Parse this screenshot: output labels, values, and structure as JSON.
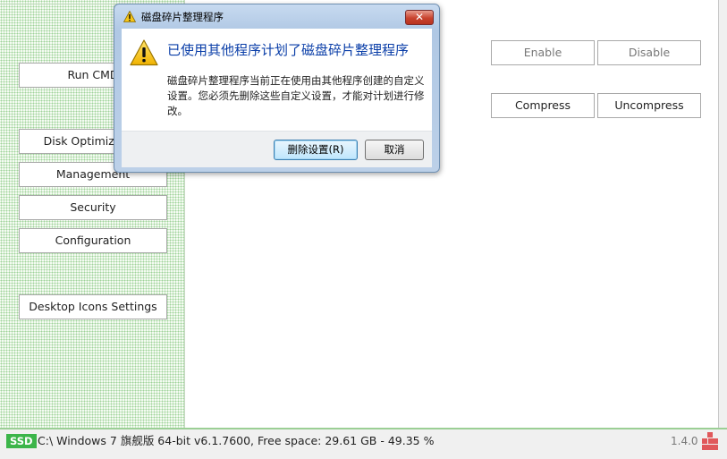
{
  "sidebar": {
    "items": [
      {
        "label": "Run CMD"
      },
      {
        "label": "Disk Optimization"
      },
      {
        "label": "Management"
      },
      {
        "label": "Security"
      },
      {
        "label": "Configuration"
      },
      {
        "label": "Desktop Icons Settings"
      }
    ]
  },
  "main": {
    "enable_label": "Enable",
    "disable_label": "Disable",
    "compress_label": "Compress",
    "uncompress_label": "Uncompress"
  },
  "status": {
    "badge": "SSD",
    "info": "C:\\ Windows 7 旗舰版  64-bit v6.1.7600, Free space: 29.61 GB - 49.35 %",
    "version": "1.4.0"
  },
  "dialog": {
    "title": "磁盘碎片整理程序",
    "close_glyph": "✕",
    "heading": "已使用其他程序计划了磁盘碎片整理程序",
    "message": "磁盘碎片整理程序当前正在使用由其他程序创建的自定义设置。您必须先删除这些自定义设置，才能对计划进行修改。",
    "delete_button": "删除设置(R)",
    "cancel_button": "取消"
  },
  "icons": {
    "title_icon": "warning-icon",
    "body_icon": "warning-icon",
    "logo": "app-logo-icon"
  },
  "colors": {
    "ssd_badge": "#3cb54a",
    "heading": "#0a3ea8",
    "close_button": "#c8432e",
    "pattern": "#9fd39a"
  }
}
